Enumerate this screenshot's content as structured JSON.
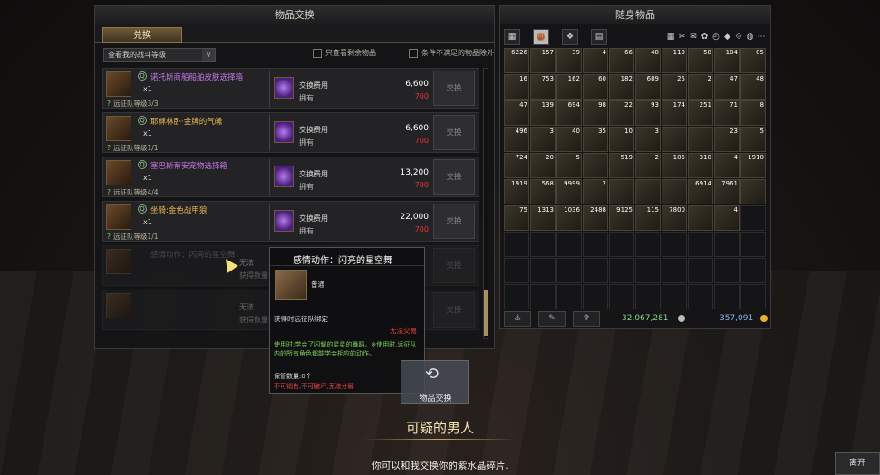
{
  "left_panel": {
    "title": "物品交换",
    "tab": "兑换",
    "filter": "查看我的战斗等级",
    "dropdown_icon": "v",
    "check1": "只查看剩余物品",
    "check2": "条件不满足的物品除外",
    "rows": [
      {
        "name": "诺托斯商船船舶皮肤选择箱",
        "qty": "x1",
        "req_num": "?",
        "req": "远征队等级3/3",
        "cost_label": "交换费用",
        "cost": "6,600",
        "have_label": "拥有",
        "have": "700",
        "btn": "交换",
        "gold": false
      },
      {
        "name": "耶稣林卧·金牌的气魄",
        "qty": "x1",
        "req_num": "?",
        "req": "远征队等级1/1",
        "cost_label": "交换费用",
        "cost": "6,600",
        "have_label": "拥有",
        "have": "700",
        "btn": "交换",
        "gold": true
      },
      {
        "name": "塞巴斯蒂安宠物选择箱",
        "qty": "x1",
        "req_num": "?",
        "req": "远征队等级4/4",
        "cost_label": "交换费用",
        "cost": "13,200",
        "have_label": "拥有",
        "have": "700",
        "btn": "交换",
        "gold": false
      },
      {
        "name": "坐骑:金色战甲狼",
        "qty": "x1",
        "req_num": "?",
        "req": "远征队等级1/1",
        "cost_label": "交换费用",
        "cost": "22,000",
        "have_label": "拥有",
        "have": "700",
        "btn": "交换",
        "gold": true
      },
      {
        "name": "感情动作：闪亮的星空舞",
        "qty": "",
        "req_num": "",
        "req": "",
        "cost_label": "无法",
        "cost": "",
        "have_label": "获得数量有",
        "have": "",
        "btn": "交换",
        "gold": false
      },
      {
        "name": "",
        "qty": "",
        "req_num": "",
        "req": "",
        "cost_label": "无法",
        "cost": "",
        "have_label": "获得数量有",
        "have": "",
        "btn": "交换",
        "gold": false
      }
    ]
  },
  "right_panel": {
    "title": "随身物品",
    "tabs": [
      "▦",
      "👜",
      "❖",
      "▤"
    ],
    "tools": [
      "▦",
      "✂",
      "✉",
      "✿",
      "◴",
      "◆",
      "⟐",
      "◍",
      "⋯"
    ],
    "grid_counts": [
      [
        "6226",
        "157",
        "39",
        "4",
        "66",
        "48",
        "119",
        "58",
        "104",
        "85"
      ],
      [
        "16",
        "753",
        "162",
        "60",
        "182",
        "689",
        "25",
        "2",
        "47",
        "48"
      ],
      [
        "47",
        "139",
        "694",
        "98",
        "22",
        "93",
        "174",
        "251",
        "71",
        "8"
      ],
      [
        "496",
        "3",
        "40",
        "35",
        "10",
        "3",
        "",
        "",
        "23",
        "5"
      ],
      [
        "724",
        "20",
        "5",
        "",
        "519",
        "2",
        "105",
        "310",
        "4",
        "1910"
      ],
      [
        "1919",
        "568",
        "9999",
        "2",
        "",
        "",
        "",
        "6914",
        "7961",
        ""
      ],
      [
        "75",
        "1313",
        "1036",
        "2488",
        "9125",
        "115",
        "7800",
        "",
        "4",
        ""
      ]
    ],
    "bottom_buttons": [
      "⚓",
      "✎",
      "♆"
    ],
    "silver": "32,067,281",
    "gold": "357,091"
  },
  "tooltip": {
    "title": "感情动作：闪亮的星空舞",
    "grade": "普通",
    "bind": "获得时远征队绑定",
    "no_trade": "无法交易",
    "use": "使用时:学会了闪耀的星星的舞蹈。※使用时,远征队内的所有角色都能学会相应的动作。",
    "keep": "保管数量:0个",
    "restrict": "不可销售,不可破坏,无法分解"
  },
  "exchange_button": {
    "icon": "⟲",
    "label": "物品交换"
  },
  "npc": {
    "name": "可疑的男人",
    "line": "你可以和我交换你的紫水晶碎片."
  },
  "leave_button": "离开",
  "colors": {
    "purple_name": "#c678e8",
    "gold_name": "#e8b454",
    "red": "#e33",
    "green": "#7ad05a"
  }
}
